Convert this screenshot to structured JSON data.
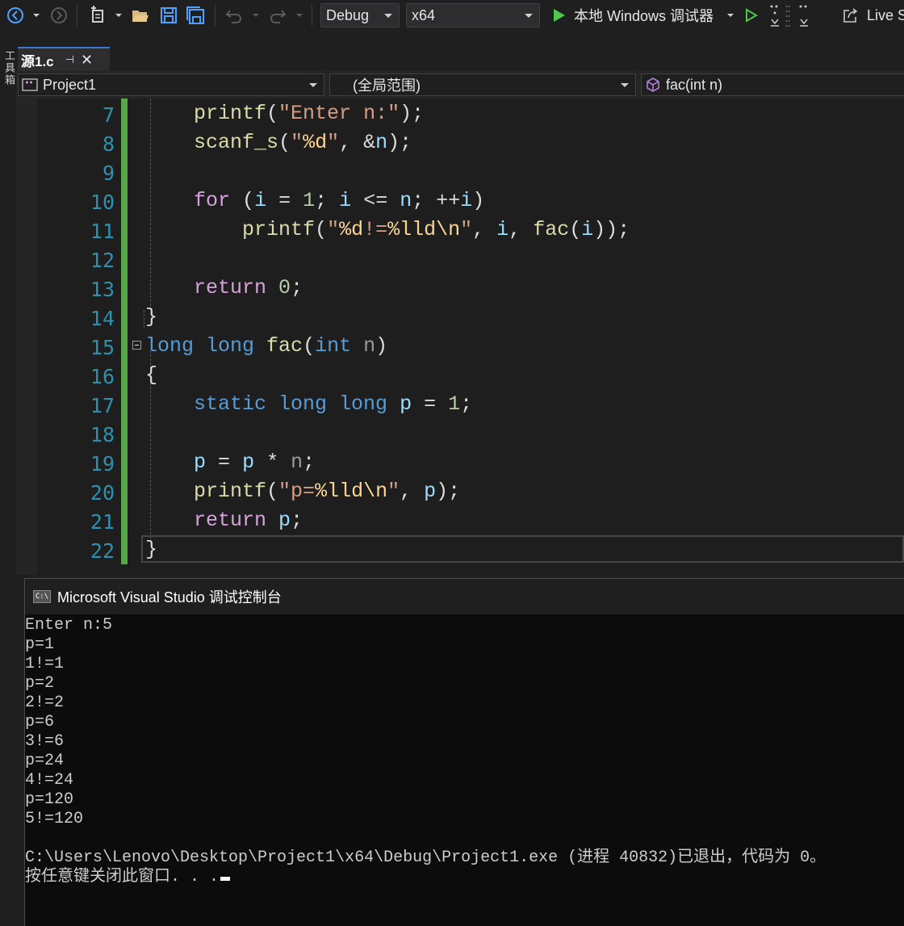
{
  "toolbar": {
    "config": "Debug",
    "platform": "x64",
    "run_label": "本地 Windows 调试器",
    "live_share": "Live S"
  },
  "left_panel": {
    "label": "工具箱"
  },
  "tab": {
    "name": "源1.c",
    "pin": "⊣",
    "close": "✕"
  },
  "nav": {
    "project": "Project1",
    "scope": "(全局范围)",
    "member": "fac(int n)"
  },
  "editor": {
    "line_numbers": [
      "7",
      "8",
      "9",
      "10",
      "11",
      "12",
      "13",
      "14",
      "15",
      "16",
      "17",
      "18",
      "19",
      "20",
      "21",
      "22"
    ]
  },
  "console": {
    "title": "Microsoft Visual Studio 调试控制台",
    "lines": [
      "Enter n:5",
      "p=1",
      "1!=1",
      "p=2",
      "2!=2",
      "p=6",
      "3!=6",
      "p=24",
      "4!=24",
      "p=120",
      "5!=120",
      "",
      "C:\\Users\\Lenovo\\Desktop\\Project1\\x64\\Debug\\Project1.exe (进程 40832)已退出，代码为 0。"
    ],
    "prompt": "按任意键关闭此窗口. . ."
  }
}
